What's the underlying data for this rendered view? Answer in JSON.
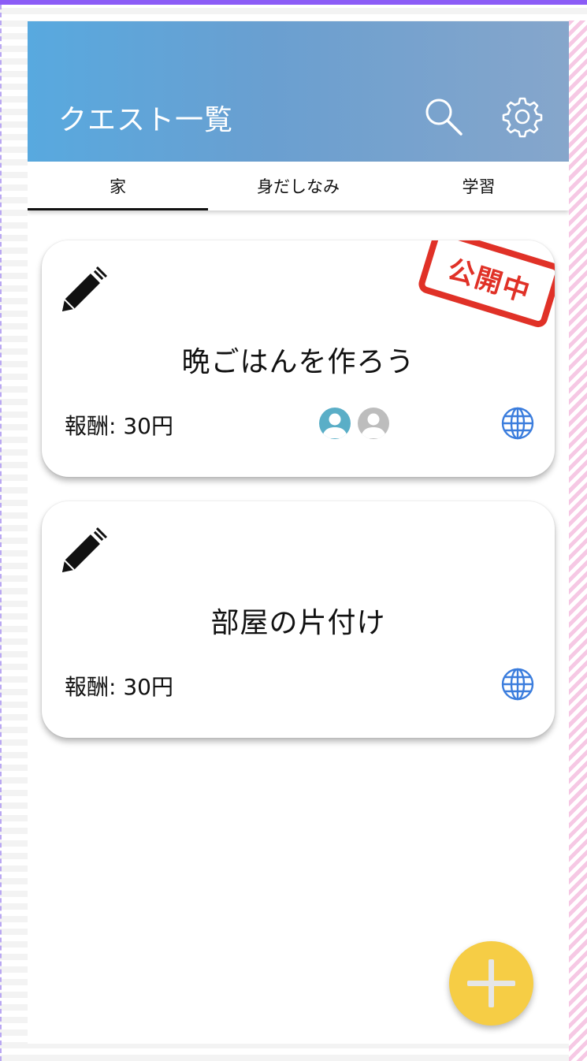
{
  "appbar": {
    "title": "クエスト一覧"
  },
  "tabs": [
    {
      "label": "家",
      "active": true
    },
    {
      "label": "身だしなみ",
      "active": false
    },
    {
      "label": "学習",
      "active": false
    }
  ],
  "quests": [
    {
      "title": "晩ごはんを作ろう",
      "reward": "報酬: 30円",
      "stamp": "公開中",
      "avatars": [
        "teal",
        "gray"
      ]
    },
    {
      "title": "部屋の片付け",
      "reward": "報酬: 30円"
    }
  ],
  "colors": {
    "appbar_start": "#58a9df",
    "appbar_end": "#86a6cb",
    "stamp": "#e03127",
    "globe": "#3b7ddd",
    "avatar_active": "#5aaec7",
    "avatar_inactive": "#bdbdbd",
    "fab": "#f6cd45"
  },
  "icons": {
    "appbar": [
      "search-icon",
      "gear-icon"
    ],
    "card": [
      "pencil-icon",
      "globe-icon",
      "person-icon"
    ],
    "fab": "plus-icon"
  }
}
